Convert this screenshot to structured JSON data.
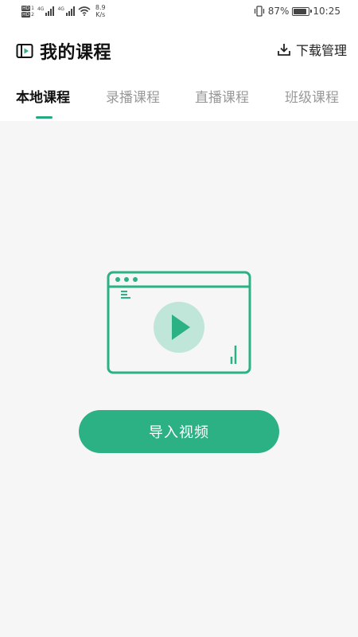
{
  "status_bar": {
    "sim1_badge": "HD",
    "sim1_num": "1",
    "sim2_badge": "HD",
    "sim2_num": "2",
    "signal1_label": "4G",
    "signal2_label": "4G",
    "net_speed_value": "8.9",
    "net_speed_unit": "K/s",
    "battery_percent": "87%",
    "battery_level": 0.87,
    "time": "10:25",
    "icons": [
      "vibrate-icon",
      "battery-icon",
      "wifi-icon",
      "signal-icon"
    ]
  },
  "header": {
    "title": "我的课程",
    "title_icon": "video-course-icon",
    "download_label": "下载管理",
    "download_icon": "download-icon"
  },
  "tabs": [
    {
      "label": "本地课程",
      "active": true
    },
    {
      "label": "录播课程",
      "active": false
    },
    {
      "label": "直播课程",
      "active": false
    },
    {
      "label": "班级课程",
      "active": false
    }
  ],
  "empty_state": {
    "illustration": "video-window-illustration",
    "import_button_label": "导入视频"
  },
  "colors": {
    "accent": "#2bb184",
    "accent_dark": "#27a97f",
    "play_circle": "#bfe6d8",
    "background": "#f6f6f6",
    "text_primary": "#111111",
    "text_inactive": "#999999"
  }
}
